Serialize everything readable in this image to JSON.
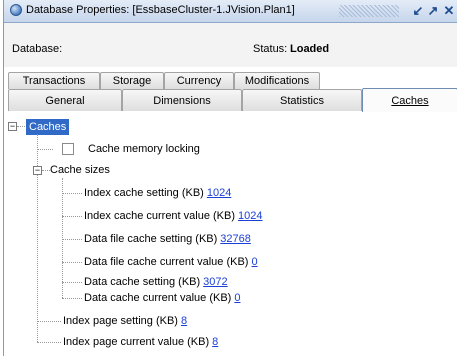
{
  "window": {
    "title": "Database Properties: [EssbaseCluster-1.JVision.Plan1]",
    "buttons": [
      "restore-icon",
      "maximize-icon",
      "close-icon"
    ]
  },
  "header": {
    "database_label": "Database:",
    "status_label": "Status:",
    "status_value": "Loaded"
  },
  "tabs": {
    "row1": [
      {
        "label": "Transactions"
      },
      {
        "label": "Storage"
      },
      {
        "label": "Currency"
      },
      {
        "label": "Modifications"
      }
    ],
    "row2": [
      {
        "label": "General"
      },
      {
        "label": "Dimensions"
      },
      {
        "label": "Statistics"
      },
      {
        "label": "Caches",
        "active": true
      }
    ]
  },
  "tree": {
    "root": "Caches",
    "memory_locking": {
      "label": "Cache memory locking",
      "checked": false
    },
    "cache_sizes": {
      "label": "Cache sizes",
      "items": [
        {
          "label": "Index cache setting (KB)",
          "value": "1024"
        },
        {
          "label": "Index cache current value (KB)",
          "value": "1024"
        },
        {
          "label": "Data file cache setting (KB)",
          "value": "32768"
        },
        {
          "label": "Data file cache current value (KB)",
          "value": "0"
        },
        {
          "label": "Data cache setting (KB)",
          "value": "3072"
        },
        {
          "label": "Data cache current value (KB)",
          "value": "0"
        }
      ]
    },
    "index_page_setting": {
      "label": "Index page setting (KB)",
      "value": "8"
    },
    "index_page_current": {
      "label": "Index page current value (KB)",
      "value": "8"
    }
  },
  "colors": {
    "selection": "#3169c6",
    "link": "#1c3fd6"
  }
}
